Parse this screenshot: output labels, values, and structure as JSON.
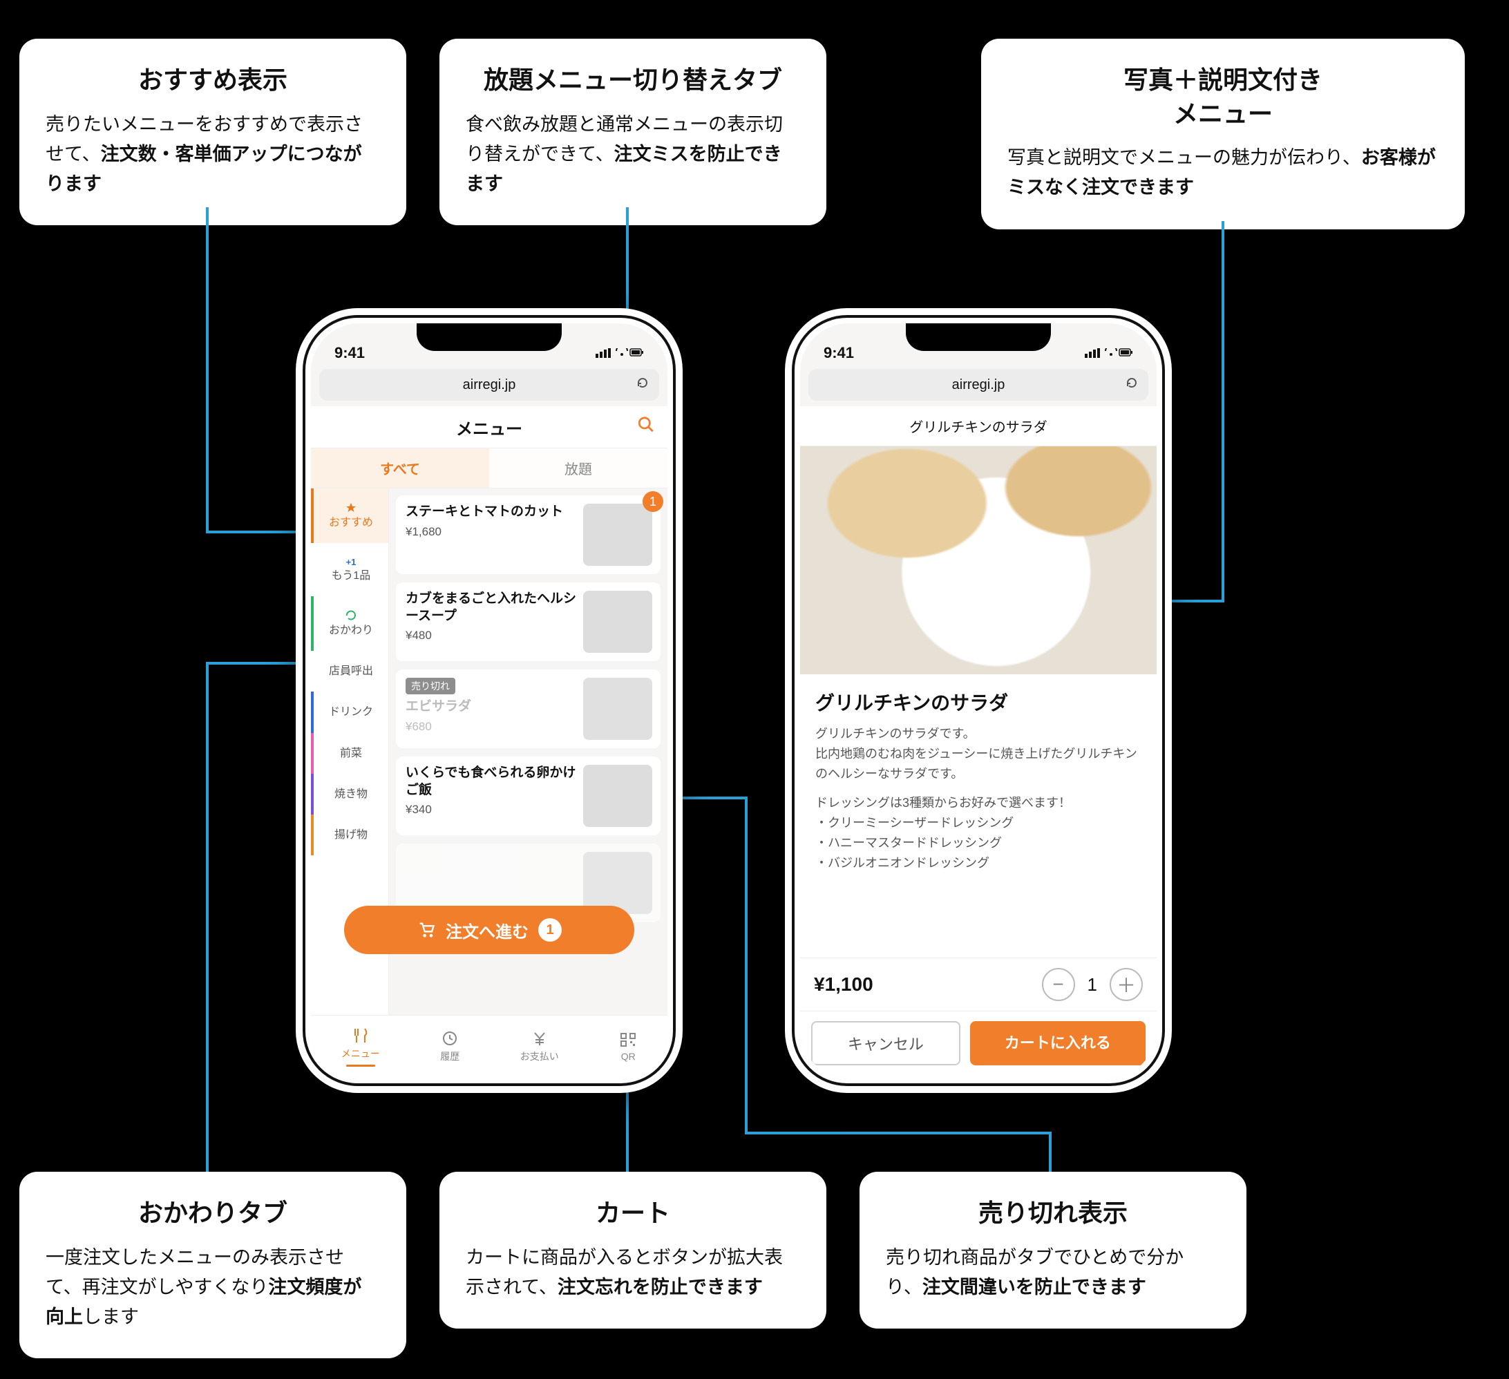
{
  "callouts": {
    "top_left": {
      "title": "おすすめ表示",
      "body_pre": "売りたいメニューをおすすめで表示させて、",
      "body_bold": "注文数・客単価アップにつながります",
      "body_post": ""
    },
    "top_mid": {
      "title": "放題メニュー切り替えタブ",
      "body_pre": "食べ飲み放題と通常メニューの表示切り替えができて、",
      "body_bold": "注文ミスを防止できます",
      "body_post": ""
    },
    "top_right": {
      "title": "写真＋説明文付き\nメニュー",
      "body_pre": "写真と説明文でメニューの魅力が伝わり、",
      "body_bold": "お客様がミスなく注文できます",
      "body_post": ""
    },
    "bot_left": {
      "title": "おかわりタブ",
      "body_pre": "一度注文したメニューのみ表示させて、再注文がしやすくなり",
      "body_bold": "注文頻度が向上",
      "body_post": "します"
    },
    "bot_mid": {
      "title": "カート",
      "body_pre": "カートに商品が入るとボタンが拡大表示されて、",
      "body_bold": "注文忘れを防止できます",
      "body_post": ""
    },
    "bot_right": {
      "title": "売り切れ表示",
      "body_pre": "売り切れ商品がタブでひとめで分かり、",
      "body_bold": "注文間違いを防止できます",
      "body_post": ""
    }
  },
  "status": {
    "time": "9:41"
  },
  "safari_url": "airregi.jp",
  "phone1": {
    "header": "メニュー",
    "tabs": {
      "all": "すべて",
      "houdai": "放題"
    },
    "side_items": [
      {
        "label": "おすすめ"
      },
      {
        "prefix": "+1",
        "label": "もう1品"
      },
      {
        "label": "おかわり"
      },
      {
        "label": "店員呼出"
      },
      {
        "label": "ドリンク"
      },
      {
        "label": "前菜"
      },
      {
        "label": "焼き物"
      },
      {
        "label": "揚げ物"
      }
    ],
    "menu_items": [
      {
        "title": "ステーキとトマトのカット",
        "price": "¥1,680",
        "badge": "1"
      },
      {
        "title": "カブをまるごと入れたヘルシースープ",
        "price": "¥480"
      },
      {
        "soldout": "売り切れ",
        "title": "エビサラダ",
        "price": "¥680"
      },
      {
        "title": "いくらでも食べられる卵かけご飯",
        "price": "¥340"
      }
    ],
    "cart_btn": {
      "label": "注文へ進む",
      "count": "1"
    },
    "bottom_nav": [
      {
        "label": "メニュー"
      },
      {
        "label": "履歴"
      },
      {
        "label": "お支払い"
      },
      {
        "label": "QR"
      }
    ]
  },
  "phone2": {
    "header": "グリルチキンのサラダ",
    "title": "グリルチキンのサラダ",
    "p1": "グリルチキンのサラダです。",
    "p2": "比内地鶏のむね肉をジューシーに焼き上げたグリルチキンのヘルシーなサラダです。",
    "p3": "ドレッシングは3種類からお好みで選べます！",
    "li1": "・クリーミーシーザードレッシング",
    "li2": "・ハニーマスタードドレッシング",
    "li3": "・バジルオニオンドレッシング",
    "price": "¥1,100",
    "qty": "1",
    "cancel": "キャンセル",
    "add": "カートに入れる"
  }
}
